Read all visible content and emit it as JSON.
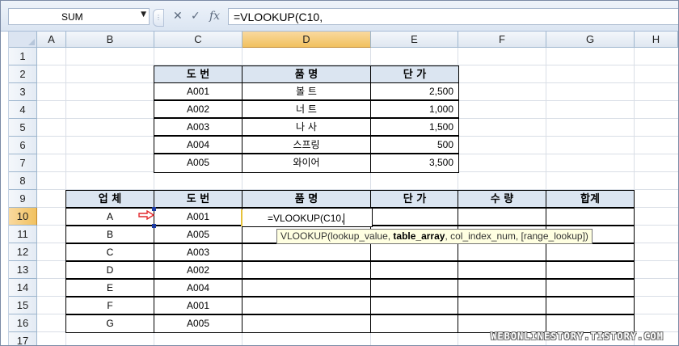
{
  "name_box": "SUM",
  "formula_buttons": {
    "cancel": "✕",
    "enter": "✓",
    "fx": "fx"
  },
  "formula_text": "=VLOOKUP(C10,",
  "columns": [
    "A",
    "B",
    "C",
    "D",
    "E",
    "F",
    "G",
    "H"
  ],
  "rows": [
    "1",
    "2",
    "3",
    "4",
    "5",
    "6",
    "7",
    "8",
    "9",
    "10",
    "11",
    "12",
    "13",
    "14",
    "15",
    "16",
    "17"
  ],
  "selected_row": "10",
  "table1": {
    "headers": [
      "도  번",
      "품  명",
      "단  가"
    ],
    "rows": [
      [
        "A001",
        "볼  트",
        "2,500"
      ],
      [
        "A002",
        "너  트",
        "1,000"
      ],
      [
        "A003",
        "나  사",
        "1,500"
      ],
      [
        "A004",
        "스프링",
        "500"
      ],
      [
        "A005",
        "와이어",
        "3,500"
      ]
    ]
  },
  "table2": {
    "headers": [
      "업 체",
      "도  번",
      "품  명",
      "단  가",
      "수  량",
      "합계"
    ],
    "rows": [
      [
        "A",
        "A001"
      ],
      [
        "B",
        "A005"
      ],
      [
        "C",
        "A003"
      ],
      [
        "D",
        "A002"
      ],
      [
        "E",
        "A004"
      ],
      [
        "F",
        "A001"
      ],
      [
        "G",
        "A005"
      ]
    ]
  },
  "editing_cell_text": "=VLOOKUP(C10,",
  "tooltip": {
    "prefix": "VLOOKUP(lookup_value, ",
    "bold": "table_array",
    "suffix": ", col_index_num, [range_lookup])"
  },
  "watermark": "WEBONLINESTORY.TISTORY.COM",
  "colors": {
    "header_fill": "#dbe5f1",
    "selected_header": "#f1c15f",
    "arrow": "#e2272b"
  }
}
